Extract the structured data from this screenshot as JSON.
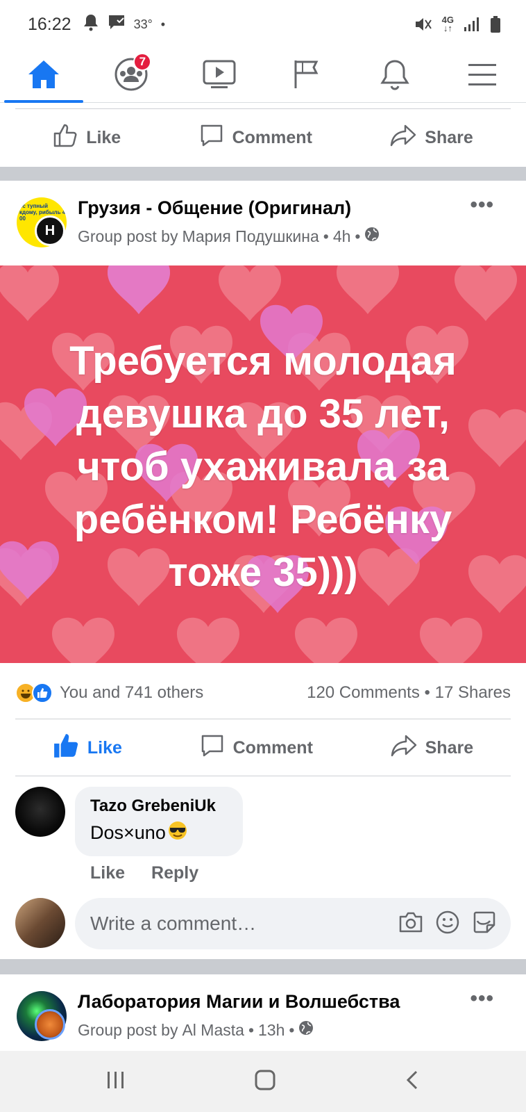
{
  "status_bar": {
    "time": "16:22",
    "temperature": "33°",
    "network": "4G"
  },
  "nav": {
    "items": [
      {
        "name": "home",
        "badge": ""
      },
      {
        "name": "groups",
        "badge": "7"
      },
      {
        "name": "watch",
        "badge": ""
      },
      {
        "name": "pages",
        "badge": ""
      },
      {
        "name": "notifications",
        "badge": ""
      },
      {
        "name": "menu",
        "badge": ""
      }
    ]
  },
  "actions": {
    "like": "Like",
    "comment": "Comment",
    "share": "Share"
  },
  "post1": {
    "group_name": "Грузия - Общение (Оригинал)",
    "subtitle_prefix": "Group post by",
    "author": "Мария Подушкина",
    "time": "4h",
    "image_text": "Требуется молодая девушка до 35 лет, чтоб ухаживала за ребёнком! Ребёнку тоже 35)))",
    "reactions_text": "You and 741 others",
    "comments_count": "120 Comments",
    "shares_count": "17 Shares",
    "comment": {
      "author": "Tazo GrebeniUk",
      "text": "Dos×uno",
      "like": "Like",
      "reply": "Reply"
    },
    "write_placeholder": "Write a comment…"
  },
  "post2": {
    "group_name": "Лаборатория Магии и Волшебства",
    "subtitle_prefix": "Group post by",
    "author": "Al Masta",
    "time": "13h"
  },
  "group_avatar_text": "ес тупный кдому, рибыль 4 00",
  "colors": {
    "accent": "#1877f2",
    "image_bg": "#e84a5f",
    "badge": "#e41e3f"
  }
}
